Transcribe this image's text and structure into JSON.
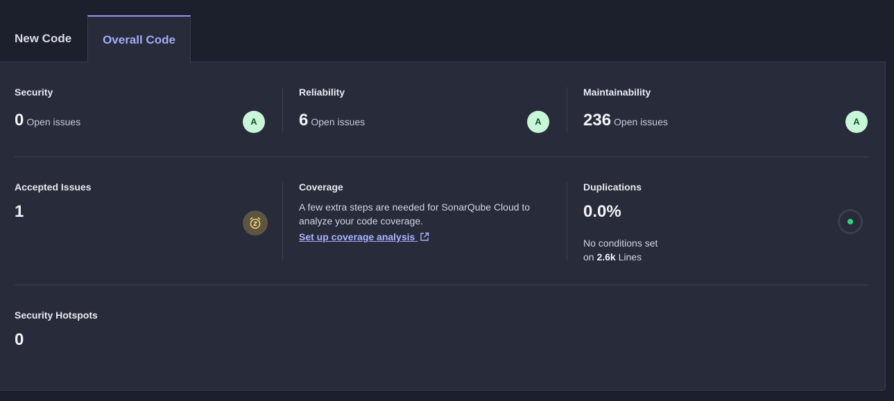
{
  "tabs": {
    "new_code": "New Code",
    "overall_code": "Overall Code"
  },
  "security": {
    "label": "Security",
    "value": "0",
    "unit": "Open issues",
    "grade": "A"
  },
  "reliability": {
    "label": "Reliability",
    "value": "6",
    "unit": "Open issues",
    "grade": "A"
  },
  "maintainability": {
    "label": "Maintainability",
    "value": "236",
    "unit": "Open issues",
    "grade": "A"
  },
  "accepted_issues": {
    "label": "Accepted Issues",
    "value": "1",
    "icon": "accepted-issue-clock-icon"
  },
  "coverage": {
    "label": "Coverage",
    "description": "A few extra steps are needed for SonarQube Cloud to analyze your code coverage.",
    "link_label": "Set up coverage analysis",
    "link_icon": "external-link-icon"
  },
  "duplications": {
    "label": "Duplications",
    "value": "0.0%",
    "note_prefix": "No conditions set",
    "note_on": "on",
    "lines_value": "2.6k",
    "lines_label": "Lines",
    "status_color": "#2fd37b"
  },
  "security_hotspots": {
    "label": "Security Hotspots",
    "value": "0"
  },
  "colors": {
    "background": "#1c1f2c",
    "panel": "#272b3a",
    "accent": "#a4acf6",
    "grade_a_bg": "#c9f5d8",
    "grade_a_text": "#0f5a33"
  }
}
